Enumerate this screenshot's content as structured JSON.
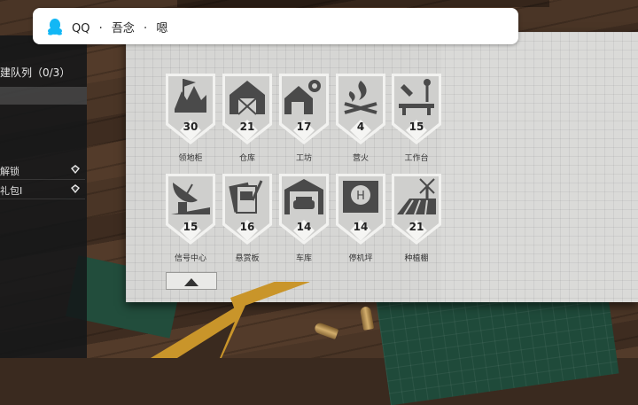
{
  "notification": {
    "app": "QQ",
    "sep1": "·",
    "sender": "吾念",
    "sep2": "·",
    "message": "嗯",
    "icon": "qq-penguin-icon"
  },
  "sidebar": {
    "title": "建队列（0/3）",
    "items": [
      {
        "label": "解锁",
        "icon": "diamond-gem-icon"
      },
      {
        "label": "礼包I",
        "icon": "diamond-gem-icon"
      }
    ]
  },
  "buildings": [
    {
      "name": "领地柜",
      "level": "30",
      "icon": "territory-flag-icon"
    },
    {
      "name": "仓库",
      "level": "21",
      "icon": "barn-icon"
    },
    {
      "name": "工坊",
      "level": "17",
      "icon": "workshop-icon"
    },
    {
      "name": "营火",
      "level": "4",
      "icon": "campfire-icon"
    },
    {
      "name": "工作台",
      "level": "15",
      "icon": "workbench-tools-icon"
    },
    {
      "name": "信号中心",
      "level": "15",
      "icon": "radar-dish-icon"
    },
    {
      "name": "悬赏板",
      "level": "16",
      "icon": "bounty-board-icon"
    },
    {
      "name": "车库",
      "level": "14",
      "icon": "garage-car-icon"
    },
    {
      "name": "停机坪",
      "level": "14",
      "icon": "helipad-icon"
    },
    {
      "name": "种植棚",
      "level": "21",
      "icon": "farm-windmill-icon"
    }
  ],
  "colors": {
    "tile": "#cfcfcd",
    "tile_art": "#4a4a4a",
    "board": "#d6d6d4",
    "sidebar": "#16181a"
  }
}
